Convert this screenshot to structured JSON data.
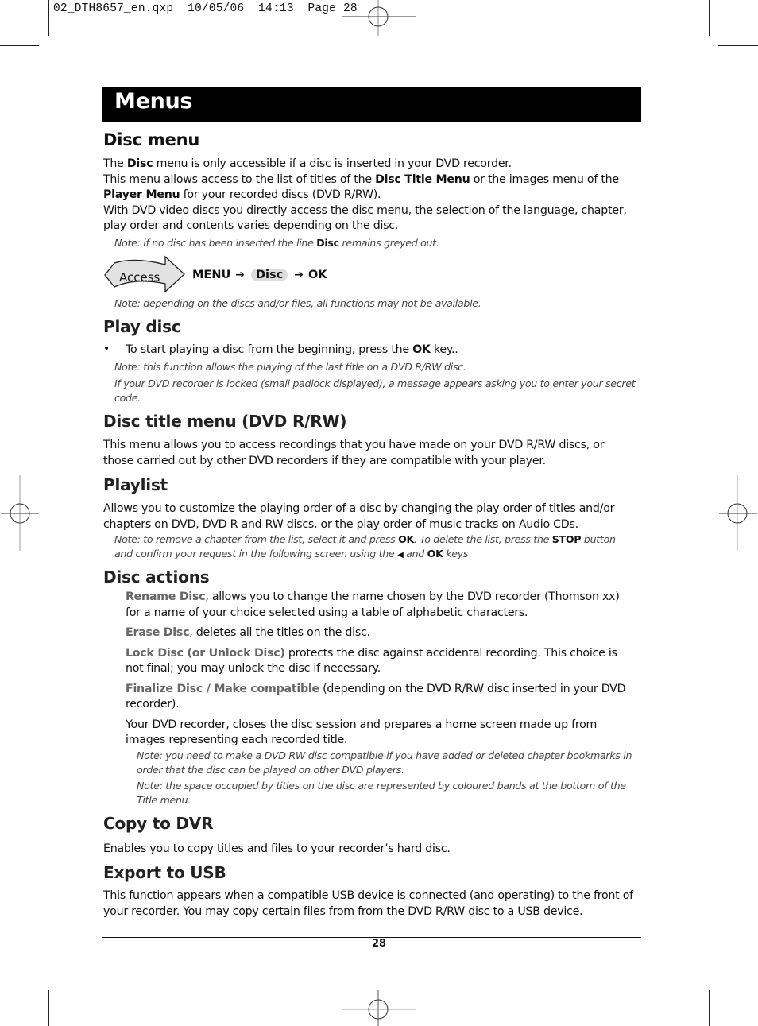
{
  "slug": "02_DTH8657_en.qxp  10/05/06  14:13  Page 28",
  "title": "Menus",
  "sections": {
    "disc_menu": {
      "heading": "Disc menu",
      "p1_a": "The ",
      "p1_b": "Disc",
      "p1_c": " menu is only accessible if a disc is inserted in your DVD recorder.",
      "p2_a": "This menu allows access to the list of titles of the ",
      "p2_b": "Disc Title Menu",
      "p2_c": " or the images menu of the ",
      "p2_d": "Player Menu",
      "p2_e": " for your recorded discs (DVD R/RW).",
      "p3": "With DVD video discs you directly access the disc menu, the selection of the language, chapter, play order and contents varies depending on the disc.",
      "note1_a": "Note: if no disc has been inserted the line ",
      "note1_b": "Disc",
      "note1_c": " remains greyed out.",
      "access": {
        "icon_label": "Access",
        "step1": "MENU",
        "step2": "Disc",
        "step3": "OK",
        "arrow": "➔"
      },
      "note2": "Note: depending on the discs and/or files, all functions may not be available."
    },
    "play_disc": {
      "heading": "Play disc",
      "bullet": "•",
      "item_a": "To start playing a disc from the beginning, press the ",
      "item_b": "OK",
      "item_c": " key..",
      "note1": "Note: this function allows the playing of the last title on a DVD R/RW disc.",
      "note2": "If your DVD recorder is locked (small padlock displayed), a message appears asking you to enter your secret code."
    },
    "disc_title_menu": {
      "heading": "Disc title menu (DVD R/RW)",
      "p1": "This menu allows you to access recordings that you have made on your DVD R/RW discs, or those carried out by other DVD recorders if they are compatible with your player."
    },
    "playlist": {
      "heading": "Playlist",
      "p1": "Allows you to customize the playing order of a disc by changing the play order of titles and/or chapters on DVD, DVD R and RW discs, or the play order of music tracks on Audio CDs.",
      "note_a": "Note: to remove a chapter from the list, select it and press ",
      "note_b": "OK",
      "note_c": ". To delete the list, press the ",
      "note_d": "STOP",
      "note_e": " button and confirm your request in the following screen using the ",
      "note_f": "◀",
      "note_g": " and ",
      "note_h": "OK",
      "note_i": " keys"
    },
    "disc_actions": {
      "heading": "Disc actions",
      "rename_term": "Rename Disc",
      "rename_text": ", allows you to change the name chosen by the DVD recorder (Thomson xx) for a name of your choice selected using a table of alphabetic characters.",
      "erase_term": "Erase Disc",
      "erase_text": ", deletes all the titles on the disc.",
      "lock_term": "Lock Disc (or Unlock Disc)",
      "lock_text": " protects the disc against accidental recording. This choice is not final; you may unlock the disc if necessary.",
      "finalize_term": "Finalize Disc / Make compatible",
      "finalize_text": " (depending on the DVD R/RW disc inserted in your DVD recorder).",
      "finalize_p2": "Your DVD recorder, closes the disc session and prepares a home screen made up from images representing each recorded title.",
      "note1": "Note: you need to make a DVD RW disc compatible if you have added or deleted chapter bookmarks in order that the disc can be played on other DVD players.",
      "note2": "Note: the space occupied by titles on the disc are represented by coloured bands at the bottom of the Title menu."
    },
    "copy_to_dvr": {
      "heading": "Copy to DVR",
      "p1": "Enables you to copy titles and files to your recorder’s hard disc."
    },
    "export_to_usb": {
      "heading": "Export to USB",
      "p1": "This function appears when a compatible USB device is connected (and operating) to the front of your recorder. You may copy certain files from from the DVD R/RW disc to a USB device."
    }
  },
  "page_number": "28"
}
